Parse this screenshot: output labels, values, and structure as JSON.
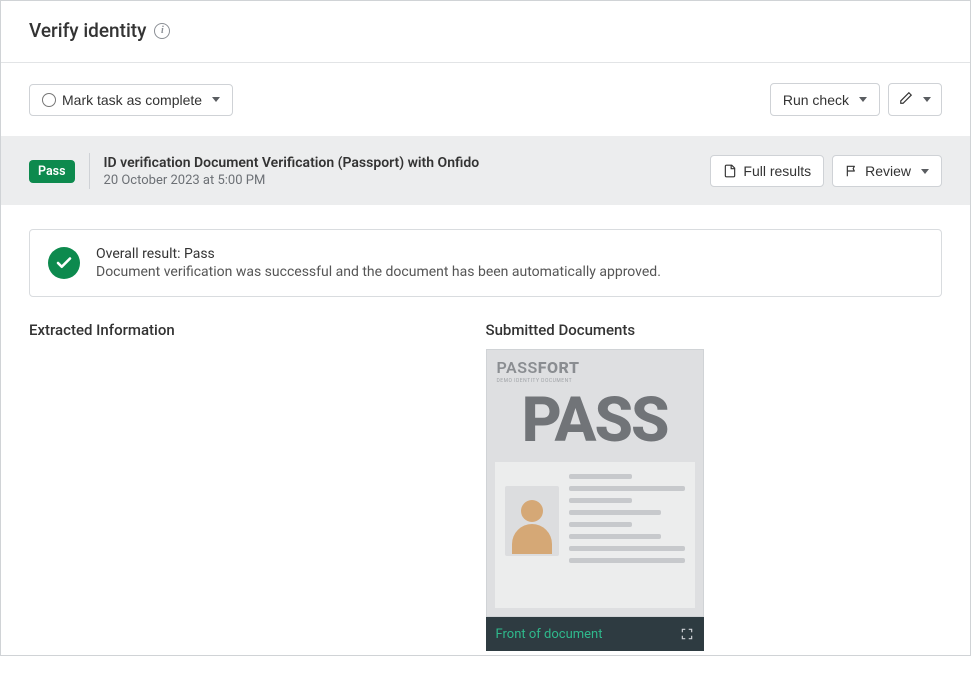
{
  "header": {
    "title": "Verify identity"
  },
  "toolbar": {
    "mark_complete": "Mark task as complete",
    "run_check": "Run check"
  },
  "result_bar": {
    "status": "Pass",
    "title": "ID verification Document Verification (Passport) with Onfido",
    "date": "20 October 2023 at 5:00 PM",
    "full_results": "Full results",
    "review": "Review"
  },
  "overall": {
    "title": "Overall result: Pass",
    "subtitle": "Document verification was successful and the document has been automatically approved."
  },
  "sections": {
    "extracted": "Extracted Information",
    "submitted": "Submitted Documents"
  },
  "document": {
    "brand_a": "PASS",
    "brand_b": "FORT",
    "brand_sub": "DEMO IDENTITY DOCUMENT",
    "big_word": "PASS",
    "footer_label": "Front of document"
  },
  "colors": {
    "pass_green": "#0d8a4e",
    "dark_footer": "#2e3b41",
    "footer_text": "#2fb98c"
  }
}
